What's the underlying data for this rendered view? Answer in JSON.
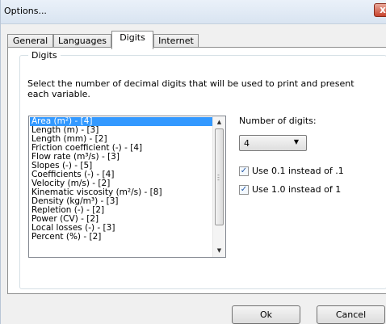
{
  "window": {
    "title": "Options...",
    "close_glyph": "x"
  },
  "tabs": [
    {
      "label": "General",
      "active": false
    },
    {
      "label": "Languages",
      "active": false
    },
    {
      "label": "Digits",
      "active": true
    },
    {
      "label": "Internet",
      "active": false
    }
  ],
  "digits_group": {
    "label": "Digits",
    "description": "Select the number of decimal digits that will be used to print and present each variable."
  },
  "variables": [
    "Area (m²) - [4]",
    "Length (m) - [3]",
    "Length (mm) - [2]",
    "Friction coefficient (-) - [4]",
    "Flow rate (m³/s) - [3]",
    "Slopes (-) - [5]",
    "Coefficients (-) - [4]",
    "Velocity (m/s) - [2]",
    "Kinematic viscosity (m²/s) - [8]",
    "Density (kg/m³) - [3]",
    "Repletion (-) - [2]",
    "Power (CV) - [2]",
    "Local losses (-) - [3]",
    "Percent (%) - [2]"
  ],
  "selected_variable_index": 0,
  "number_of_digits": {
    "label": "Number of digits:",
    "value": "4"
  },
  "checkboxes": [
    {
      "label": "Use 0.1 instead of .1",
      "checked": true
    },
    {
      "label": "Use 1.0 instead of 1",
      "checked": true
    }
  ],
  "buttons": {
    "ok": "Ok",
    "cancel": "Cancel"
  },
  "icons": {
    "close": "close-icon",
    "scroll_up": "scroll-up-icon",
    "scroll_down": "scroll-down-icon",
    "dropdown": "chevron-down-icon",
    "check": "checkmark-icon"
  },
  "colors": {
    "selection": "#3399ff",
    "titlebar": "#dfe8f3",
    "close": "#c7432e",
    "checkmark": "#2458a6"
  }
}
